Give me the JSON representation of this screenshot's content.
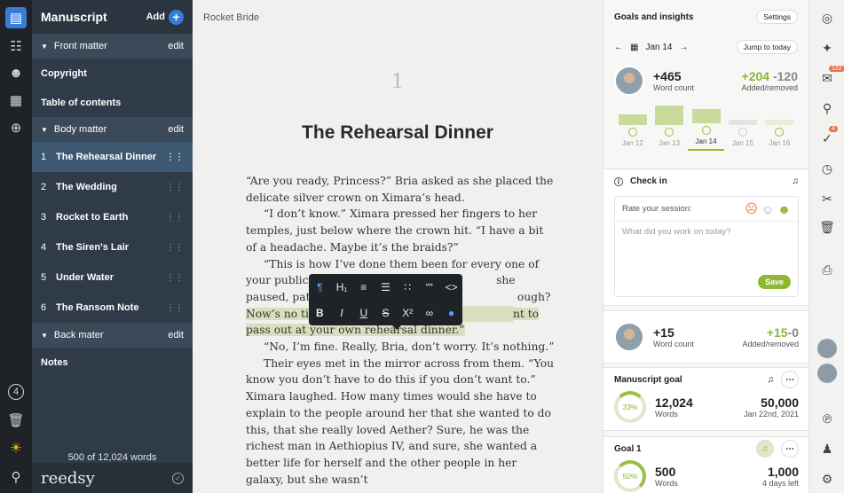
{
  "left_rail": {
    "badge": "4"
  },
  "sidebar": {
    "title": "Manuscript",
    "add_label": "Add",
    "sections": [
      {
        "label": "Front matter",
        "edit": "edit"
      },
      {
        "label": "Body matter",
        "edit": "edit"
      },
      {
        "label": "Back mater",
        "edit": "edit"
      }
    ],
    "front_items": [
      "Copyright",
      "Table of contents"
    ],
    "chapters": [
      {
        "num": "1",
        "label": "The Rehearsal Dinner"
      },
      {
        "num": "2",
        "label": "The Wedding"
      },
      {
        "num": "3",
        "label": "Rocket to Earth"
      },
      {
        "num": "4",
        "label": "The Siren's Lair"
      },
      {
        "num": "5",
        "label": "Under Water"
      },
      {
        "num": "6",
        "label": "The Ransom Note"
      }
    ],
    "back_items": [
      "Notes"
    ],
    "word_count": "500 of 12,024 words",
    "brand": "reedsy"
  },
  "editor": {
    "book_title": "Rocket Bride",
    "chapter_number": "1",
    "chapter_title": "The Rehearsal Dinner",
    "p1": "“Are you ready, Princess?” Bria asked as she placed the delicate silver crown on Ximara’s head.",
    "p2": "“I don’t know.” Ximara pressed her fingers to her temples, just below where the crown hit. “I have a bit of a headache. Maybe it’s the braids?”",
    "p3a": "“This is how I’ve done them been for every one of your public appea",
    "p3b": "she paused, patting Xima",
    "p3c": "ough?",
    "p3d": "Now’s no ti",
    "p3e": "nt to pass out at your own rehearsal dinner.”",
    "p4": "“No, I’m fine. Really, Bria, don’t worry. It’s nothing.”",
    "p5": "Their eyes met in the mirror across from them. “You know you don’t have to do this if you don’t want to.” Ximara laughed. How many times would she have to explain to the people around her that she wanted to do this, that she really loved Aether? Sure, he was the richest man in Aethiopius IV, and sure, she wanted a better life for herself and the other people in her galaxy, but she wasn’t"
  },
  "toolbar": {
    "row1": [
      "¶",
      "H₁",
      "≡",
      "☰",
      "∷",
      "““",
      "<>"
    ],
    "row2": [
      "B",
      "I",
      "U",
      "S",
      "X²",
      "∞",
      "●"
    ]
  },
  "panel": {
    "title": "Goals and insights",
    "settings": "Settings",
    "date": "Jan 14",
    "jump": "Jump to today",
    "today": {
      "count": "+465",
      "count_label": "Word count",
      "added": "+204",
      "removed": "-120",
      "ar_label": "Added/removed"
    },
    "days": [
      "Jan 12",
      "Jan 13",
      "Jan 14",
      "Jan 15",
      "Jan 16"
    ],
    "day_levels": [
      0.35,
      0.75,
      0.5,
      0.1,
      0.1
    ],
    "checkin": {
      "title": "Check in",
      "rate": "Rate your session:",
      "placeholder": "What did you work on today?",
      "save": "Save"
    },
    "other": {
      "count": "+15",
      "count_label": "Word count",
      "added": "+15",
      "removed": "-0",
      "ar_label": "Added/removed"
    },
    "manuscript_goal": {
      "title": "Manuscript goal",
      "pct": "33%",
      "words": "12,024",
      "words_label": "Words",
      "target": "50,000",
      "date": "Jan 22nd, 2021"
    },
    "goal1": {
      "title": "Goal 1",
      "pct": "50%",
      "words": "500",
      "words_label": "Words",
      "target": "1,000",
      "left": "4 days left"
    }
  },
  "right_rail": {
    "badge1": "122",
    "badge2": "4"
  },
  "colors": {
    "accent_blue": "#3a7bd5",
    "accent_green": "#8db832",
    "sidebar": "#2f3b48"
  }
}
